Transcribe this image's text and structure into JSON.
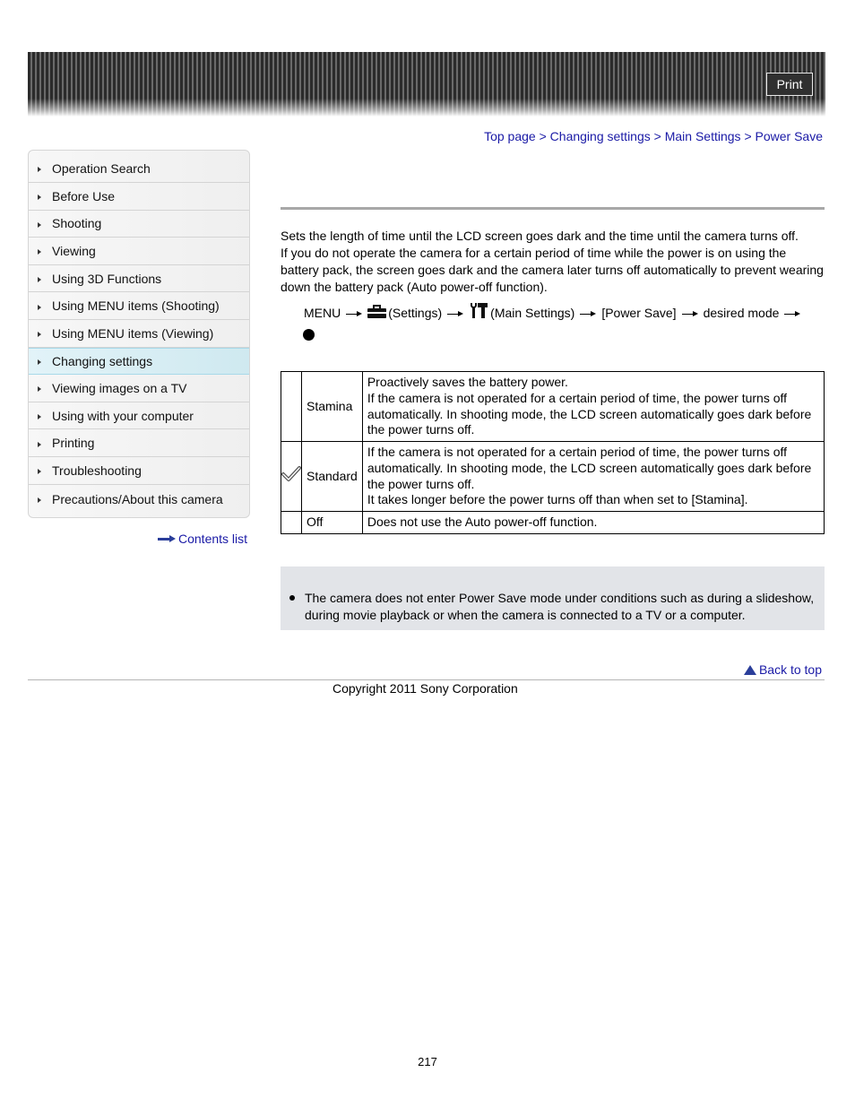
{
  "header": {
    "print_label": "Print"
  },
  "breadcrumb": {
    "items": [
      "Top page",
      "Changing settings",
      "Main Settings",
      "Power Save"
    ],
    "separator": ">"
  },
  "sidebar": {
    "items": [
      {
        "label": "Operation Search",
        "active": false
      },
      {
        "label": "Before Use",
        "active": false
      },
      {
        "label": "Shooting",
        "active": false
      },
      {
        "label": "Viewing",
        "active": false
      },
      {
        "label": "Using 3D Functions",
        "active": false
      },
      {
        "label": "Using MENU items (Shooting)",
        "active": false
      },
      {
        "label": "Using MENU items (Viewing)",
        "active": false
      },
      {
        "label": "Changing settings",
        "active": true
      },
      {
        "label": "Viewing images on a TV",
        "active": false
      },
      {
        "label": "Using with your computer",
        "active": false
      },
      {
        "label": "Printing",
        "active": false
      },
      {
        "label": "Troubleshooting",
        "active": false
      },
      {
        "label": "Precautions/About this camera",
        "active": false
      }
    ],
    "contents_link": "Contents list"
  },
  "main": {
    "intro_lines": [
      "Sets the length of time until the LCD screen goes dark and the time until the camera turns off.",
      "If you do not operate the camera for a certain period of time while the power is on using the battery pack, the screen goes dark and the camera later turns off automatically to prevent wearing down the battery pack (Auto power-off function)."
    ],
    "procedure": {
      "menu": "MENU",
      "settings": "(Settings)",
      "main_settings": "(Main Settings)",
      "power_save": "[Power Save]",
      "desired_mode": "desired mode",
      "settings_icon": "toolbox-icon",
      "main_settings_icon": "wrench-hammer-icon",
      "final_icon": "center-button-dot-icon"
    },
    "modes": [
      {
        "default": false,
        "name": "Stamina",
        "lines": [
          "Proactively saves the battery power.",
          "If the camera is not operated for a certain period of time, the power turns off automatically. In shooting mode, the LCD screen automatically goes dark before the power turns off."
        ]
      },
      {
        "default": true,
        "name": "Standard",
        "lines": [
          "If the camera is not operated for a certain period of time, the power turns off automatically. In shooting mode, the LCD screen automatically goes dark before the power turns off.",
          "It takes longer before the power turns off than when set to [Stamina]."
        ]
      },
      {
        "default": false,
        "name": "Off",
        "lines": [
          "Does not use the Auto power-off function."
        ]
      }
    ],
    "note": "The camera does not enter Power Save mode under conditions such as during a slideshow, during movie playback or when the camera is connected to a TV or a computer."
  },
  "footer": {
    "back_to_top": "Back to top",
    "copyright": "Copyright 2011 Sony Corporation",
    "page_number": "217"
  }
}
